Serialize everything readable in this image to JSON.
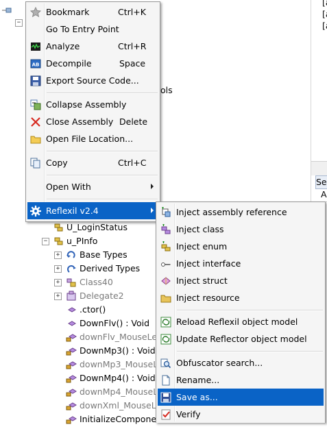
{
  "tree": {
    "partial_text": "ols",
    "rows": [
      {
        "label": "U_LoginStatus",
        "gray": false
      },
      {
        "label": "u_PInfo",
        "gray": false
      },
      {
        "label": "Base Types",
        "gray": false
      },
      {
        "label": "Derived Types",
        "gray": false
      },
      {
        "label": "Class40",
        "gray": true
      },
      {
        "label": "Delegate2",
        "gray": true
      },
      {
        "label": ".ctor()",
        "gray": false
      },
      {
        "label": "DownFlv() : Void",
        "gray": false
      },
      {
        "label": "downFlv_MouseLeft",
        "gray": true
      },
      {
        "label": "DownMp3() : Void",
        "gray": false
      },
      {
        "label": "downMp3_MouseL",
        "gray": true
      },
      {
        "label": "DownMp4() : Void",
        "gray": false
      },
      {
        "label": "downMp4_MouseL",
        "gray": true
      },
      {
        "label": "downXml_MouseLe",
        "gray": true
      },
      {
        "label": "InitializeComponen",
        "gray": false
      }
    ]
  },
  "right_panel": {
    "bracket_lines": [
      "[a",
      "[a",
      "[a"
    ],
    "se_text": "Se",
    "a_text": "A"
  },
  "context_menu": {
    "items": [
      {
        "label": "Bookmark",
        "shortcut": "Ctrl+K",
        "icon": "star-icon"
      },
      {
        "label": "Go To Entry Point",
        "shortcut": "",
        "icon": ""
      },
      {
        "label": "Analyze",
        "shortcut": "Ctrl+R",
        "icon": "analyze-icon"
      },
      {
        "label": "Decompile",
        "shortcut": "Space",
        "icon": "decompile-icon"
      },
      {
        "label": "Export Source Code...",
        "shortcut": "",
        "icon": "save-icon"
      },
      {
        "label": "Collapse Assembly",
        "shortcut": "",
        "icon": "collapse-icon"
      },
      {
        "label": "Close Assembly",
        "shortcut": "Delete",
        "icon": "close-icon"
      },
      {
        "label": "Open File Location...",
        "shortcut": "",
        "icon": "folder-icon"
      },
      {
        "label": "Copy",
        "shortcut": "Ctrl+C",
        "icon": "copy-icon"
      },
      {
        "label": "Open With",
        "shortcut": "",
        "icon": ""
      },
      {
        "label": "Reflexil v2.4",
        "shortcut": "",
        "icon": "gear-icon"
      }
    ]
  },
  "submenu": {
    "items": [
      {
        "label": "Inject assembly reference"
      },
      {
        "label": "Inject class"
      },
      {
        "label": "Inject enum"
      },
      {
        "label": "Inject interface"
      },
      {
        "label": "Inject struct"
      },
      {
        "label": "Inject resource"
      },
      {
        "label": "Reload Reflexil object model"
      },
      {
        "label": "Update Reflector object model"
      },
      {
        "label": "Obfuscator search..."
      },
      {
        "label": "Rename..."
      },
      {
        "label": "Save as..."
      },
      {
        "label": "Verify"
      }
    ]
  },
  "colors": {
    "highlight": "#0a63c6",
    "menu_bg": "#f5f5f5"
  }
}
